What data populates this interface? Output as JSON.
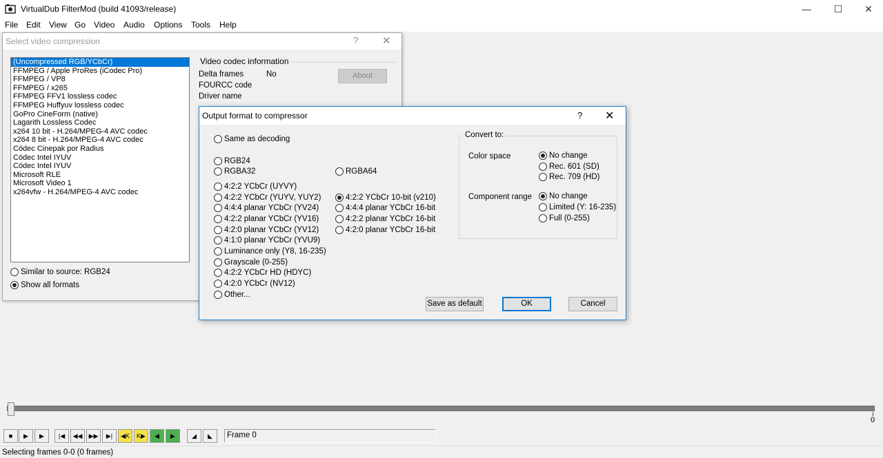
{
  "window": {
    "title": "VirtualDub FilterMod  (build 41093/release)",
    "controls": {
      "minimize": "—",
      "maximize": "☐",
      "close": "✕"
    }
  },
  "menu": [
    "File",
    "Edit",
    "View",
    "Go",
    "Video",
    "Audio",
    "Options",
    "Tools",
    "Help"
  ],
  "compression_dialog": {
    "title": "Select video compression",
    "help": "?",
    "close": "✕",
    "codecs": [
      "(Uncompressed RGB/YCbCr)",
      "FFMPEG / Apple ProRes (iCodec Pro)",
      "FFMPEG / VP8",
      "FFMPEG / x265",
      "FFMPEG FFV1 lossless codec",
      "FFMPEG Huffyuv lossless codec",
      "GoPro CineForm (native)",
      "Lagarith Lossless Codec",
      "x264 10 bit - H.264/MPEG-4 AVC codec",
      "x264 8 bit - H.264/MPEG-4 AVC codec",
      "Códec Cinepak por Radius",
      "Códec Intel IYUV",
      "Códec Intel IYUV",
      "Microsoft RLE",
      "Microsoft Video 1",
      "x264vfw - H.264/MPEG-4 AVC codec"
    ],
    "selected_codec_index": 0,
    "info_group_title": "Video codec information",
    "delta_frames_label": "Delta frames",
    "delta_frames_value": "No",
    "fourcc_label": "FOURCC code",
    "driver_label": "Driver name",
    "about_button": "About",
    "similar_label": "Similar to source: RGB24",
    "show_all_label": "Show all formats"
  },
  "output_dialog": {
    "title": "Output format to compressor",
    "help": "?",
    "close": "✕",
    "formats_left": {
      "same": "Same as decoding",
      "rgb24": "RGB24",
      "rgba32": "RGBA32",
      "uyvy": "4:2:2 YCbCr (UYVY)",
      "yuyv": "4:2:2 YCbCr (YUYV, YUY2)",
      "yv24": "4:4:4 planar YCbCr (YV24)",
      "yv16": "4:2:2 planar YCbCr (YV16)",
      "yv12": "4:2:0 planar YCbCr (YV12)",
      "yvu9": "4:1:0 planar YCbCr (YVU9)",
      "y8": "Luminance only (Y8, 16-235)",
      "gray": "Grayscale (0-255)",
      "hdyc": "4:2:2 YCbCr HD (HDYC)",
      "nv12": "4:2:0 YCbCr (NV12)",
      "other": "Other..."
    },
    "formats_right": {
      "rgba64": "RGBA64",
      "v210": "4:2:2 YCbCr 10-bit (v210)",
      "p444_16": "4:4:4 planar YCbCr 16-bit",
      "p422_16": "4:2:2 planar YCbCr 16-bit",
      "p420_16": "4:2:0 planar YCbCr 16-bit"
    },
    "selected_format": "4:2:2 YCbCr 10-bit (v210)",
    "convert_group_title": "Convert to:",
    "color_space_label": "Color space",
    "color_space_options": [
      "No change",
      "Rec. 601 (SD)",
      "Rec. 709 (HD)"
    ],
    "color_space_selected": "No change",
    "range_label": "Component range",
    "range_options": [
      "No change",
      "Limited (Y: 16-235)",
      "Full (0-255)"
    ],
    "range_selected": "No change",
    "save_default_button": "Save as default",
    "ok_button": "OK",
    "cancel_button": "Cancel"
  },
  "timeline": {
    "start_label": "0",
    "end_label": "0"
  },
  "toolbar": {
    "frame_label": "Frame 0"
  },
  "status": {
    "text": "Selecting frames 0-0 (0 frames)"
  }
}
